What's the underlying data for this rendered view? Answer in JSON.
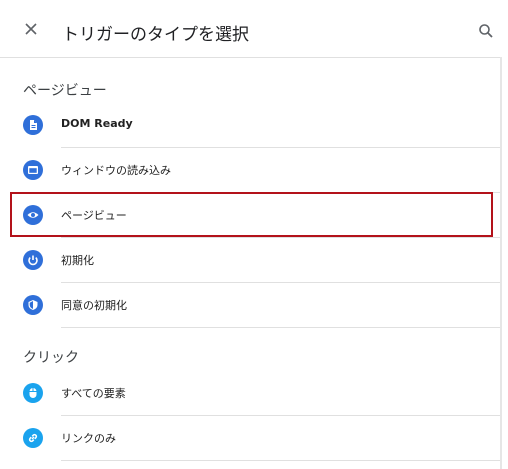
{
  "header": {
    "title": "トリガーのタイプを選択",
    "close_icon": "close-icon",
    "search_icon": "search-icon"
  },
  "sections": [
    {
      "label": "ページビュー",
      "items": [
        {
          "label": "DOM Ready",
          "icon": "document-icon"
        },
        {
          "label": "ウィンドウの読み込み",
          "icon": "window-icon"
        },
        {
          "label": "ページビュー",
          "icon": "eye-icon"
        },
        {
          "label": "初期化",
          "icon": "power-icon"
        },
        {
          "label": "同意の初期化",
          "icon": "shield-icon"
        }
      ]
    },
    {
      "label": "クリック",
      "items": [
        {
          "label": "すべての要素",
          "icon": "mouse-icon"
        },
        {
          "label": "リンクのみ",
          "icon": "link-icon"
        }
      ]
    }
  ],
  "colors": {
    "icon_blue": "#2f6fd9",
    "icon_light_blue": "#1aa3ee",
    "highlight_border": "#b3121a"
  }
}
